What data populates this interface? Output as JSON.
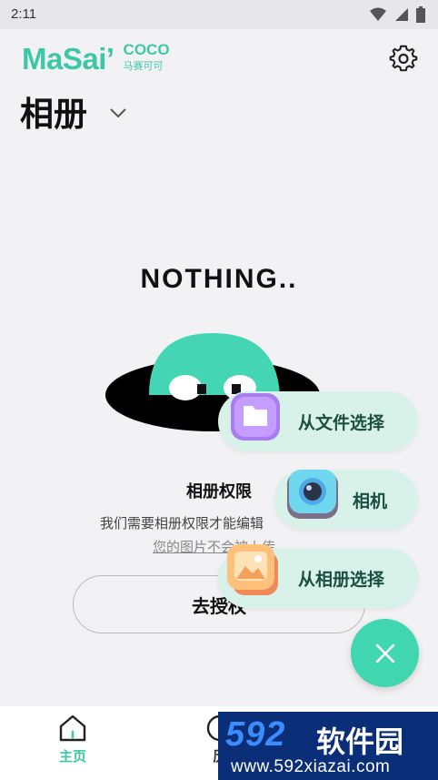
{
  "status_bar": {
    "time": "2:11"
  },
  "header": {
    "logo_main": "MaSai’",
    "logo_coco": "COCO",
    "logo_cn": "马赛可可",
    "title": "相册"
  },
  "empty_state": {
    "headline": "NOTHING..",
    "permission_title": "相册权限",
    "permission_desc": "我们需要相册权限才能编辑",
    "permission_link": "您的图片不会被上传",
    "auth_button": "去授权"
  },
  "action_menu": {
    "items": [
      {
        "label": "从文件选择",
        "icon": "folder-icon"
      },
      {
        "label": "相机",
        "icon": "camera-icon"
      },
      {
        "label": "从相册选择",
        "icon": "photo-album-icon"
      }
    ],
    "fab_icon": "close-icon"
  },
  "bottom_nav": {
    "items": [
      {
        "label": "主页",
        "icon": "home-icon",
        "active": true
      },
      {
        "label": "历",
        "icon": "history-icon",
        "active": false
      }
    ]
  },
  "watermark": {
    "brand": "592",
    "brand_cn": "软件园",
    "url": "www.592xiazai.com"
  },
  "colors": {
    "accent": "#3ec7a6",
    "fab": "#3fd6b0",
    "pill": "#d8f2ea"
  }
}
